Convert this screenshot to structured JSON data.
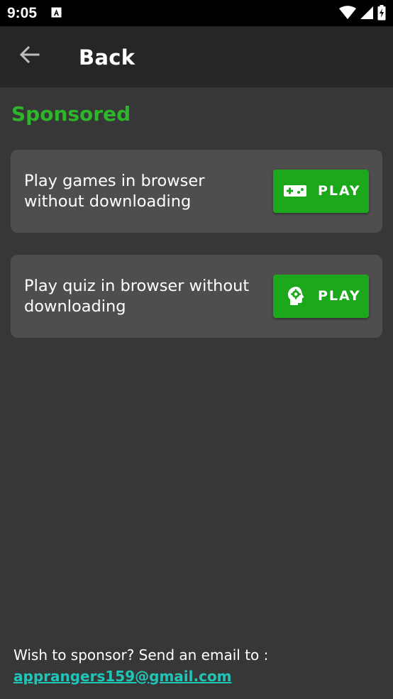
{
  "status_bar": {
    "time": "9:05",
    "icons": [
      "notification-a-icon",
      "wifi-icon",
      "signal-icon",
      "battery-charging-icon"
    ]
  },
  "app_bar": {
    "title": "Back",
    "back_icon": "arrow-left-icon"
  },
  "section": {
    "title": "Sponsored"
  },
  "cards": [
    {
      "text": "Play games in browser without downloading",
      "button_label": "PLAY",
      "button_icon": "gamepad-icon"
    },
    {
      "text": "Play quiz in browser without downloading",
      "button_label": "PLAY",
      "button_icon": "head-gear-icon"
    }
  ],
  "footer": {
    "text": "Wish to sponsor? Send an email to :",
    "email": "apprangers159@gmail.com"
  },
  "colors": {
    "background": "#373737",
    "app_bar": "#262626",
    "card": "#4f4d4e",
    "accent_green": "#2db52c",
    "button_green": "#1ca81b",
    "link": "#1fc6b7"
  }
}
